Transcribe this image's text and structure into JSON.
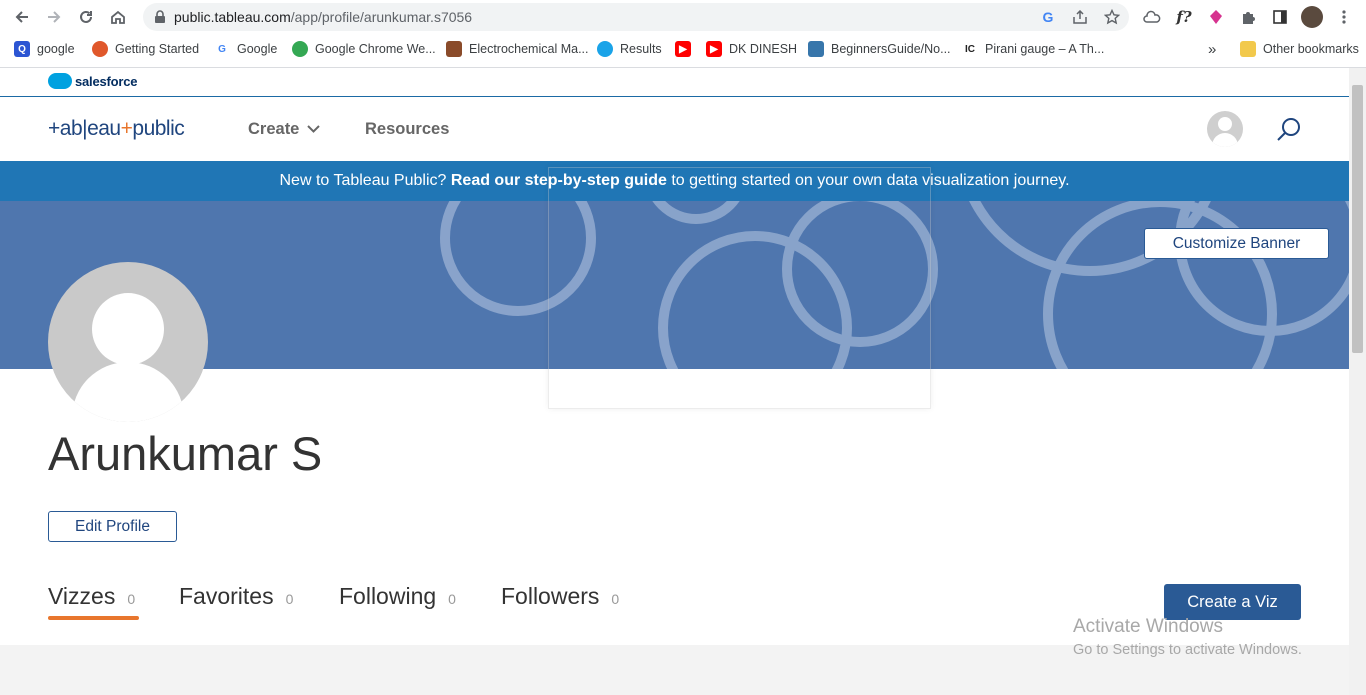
{
  "browser": {
    "url_host": "public.tableau.com",
    "url_path": "/app/profile/arunkumar.s7056",
    "bookmarks": [
      {
        "label": "google",
        "color": "#2c55d3",
        "icon": "g-icon"
      },
      {
        "label": "Getting Started",
        "color": "#e0582b",
        "icon": "firefox-icon"
      },
      {
        "label": "Google",
        "color": "#4285f4",
        "icon": "google-icon"
      },
      {
        "label": "Google Chrome We...",
        "color": "#34a853",
        "icon": "chrome-icon"
      },
      {
        "label": "Electrochemical Ma...",
        "color": "#8a4b2a",
        "icon": "electrochem-icon"
      },
      {
        "label": "Results",
        "color": "#1aa3e8",
        "icon": "globe-icon"
      },
      {
        "label": "",
        "color": "#ff0000",
        "icon": "youtube-icon"
      },
      {
        "label": "DK DINESH",
        "color": "#ff0000",
        "icon": "youtube-icon"
      },
      {
        "label": "BeginnersGuide/No...",
        "color": "#3776ab",
        "icon": "python-icon"
      },
      {
        "label": "Pirani gauge – A Th...",
        "color": "#222222",
        "icon": "ic-icon"
      }
    ],
    "more_bookmarks": "»",
    "other_bookmarks": "Other bookmarks"
  },
  "salesforce": {
    "label": "salesforce"
  },
  "header": {
    "logo_left": "+ab|eau",
    "logo_plus": "+",
    "logo_right": "public",
    "nav_create": "Create",
    "nav_resources": "Resources"
  },
  "announcement": {
    "pre": "New to Tableau Public?",
    "bold": "Read our step-by-step guide",
    "post": "to getting started on your own data visualization journey."
  },
  "banner": {
    "customize_label": "Customize Banner",
    "color": "#4f76ae"
  },
  "profile": {
    "name": "Arunkumar S",
    "edit_label": "Edit Profile"
  },
  "tabs": [
    {
      "label": "Vizzes",
      "count": "0"
    },
    {
      "label": "Favorites",
      "count": "0"
    },
    {
      "label": "Following",
      "count": "0"
    },
    {
      "label": "Followers",
      "count": "0"
    }
  ],
  "create_viz_label": "Create a Viz",
  "watermark": {
    "line1": "Activate Windows",
    "line2": "Go to Settings to activate Windows."
  }
}
